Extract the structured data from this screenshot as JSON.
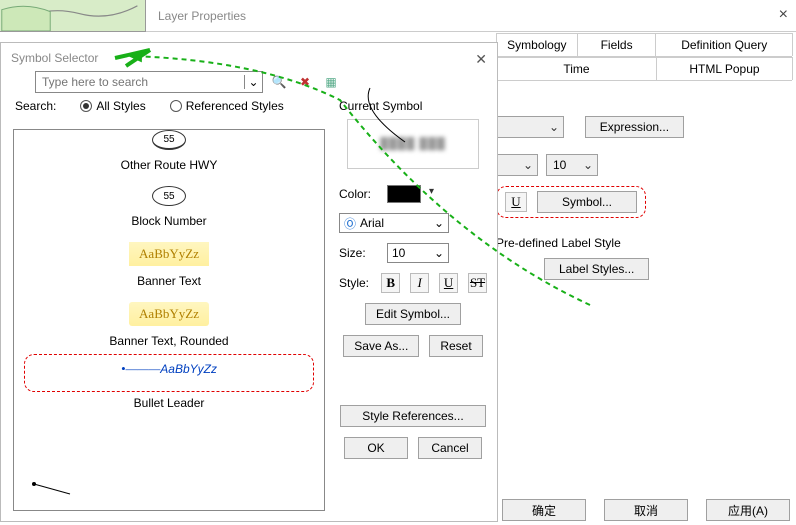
{
  "window": {
    "title": "Layer Properties"
  },
  "tabs": {
    "row1": [
      "Symbology",
      "Fields",
      "Definition Query"
    ],
    "row2": [
      "Time",
      "HTML Popup"
    ]
  },
  "right": {
    "expression_btn": "Expression...",
    "size_value": "10",
    "symbol_btn": "Symbol...",
    "predef_label": "Pre-defined Label Style",
    "label_styles_btn": "Label Styles..."
  },
  "footer": {
    "ok": "确定",
    "cancel": "取消",
    "apply": "应用(A)"
  },
  "symsel": {
    "title": "Symbol Selector",
    "search_placeholder": "Type here to search",
    "search_label": "Search:",
    "all_styles": "All Styles",
    "ref_styles": "Referenced Styles",
    "items": [
      {
        "glyph_text": "55",
        "label": "Other Route HWY"
      },
      {
        "glyph_text": "55",
        "label": "Block Number"
      },
      {
        "glyph_text": "AaBbYyZz",
        "label": "Banner Text"
      },
      {
        "glyph_text": "AaBbYyZz",
        "label": "Banner Text, Rounded"
      },
      {
        "glyph_text": "AaBbYyZz",
        "label": "Bullet Leader"
      }
    ],
    "current_symbol": "Current Symbol",
    "color_label": "Color:",
    "font_name": "Arial",
    "size_label": "Size:",
    "size_value": "10",
    "style_label": "Style:",
    "fmt": {
      "b": "B",
      "i": "I",
      "u": "U",
      "s": "ST"
    },
    "edit_symbol": "Edit Symbol...",
    "save_as": "Save As...",
    "reset": "Reset",
    "style_refs": "Style References...",
    "ok": "OK",
    "cancel": "Cancel"
  }
}
